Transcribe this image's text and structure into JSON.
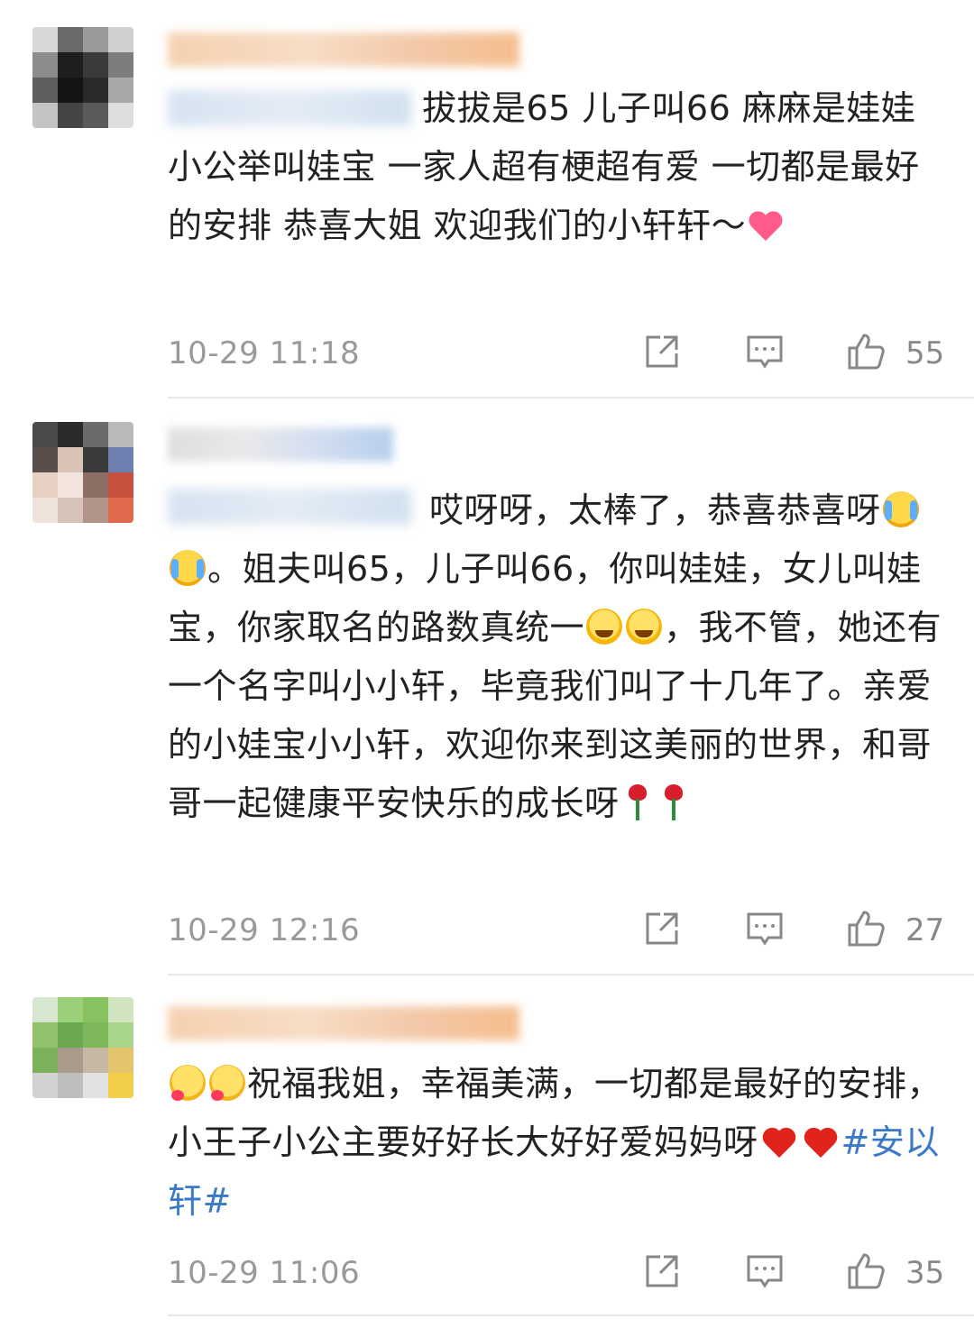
{
  "comments": [
    {
      "text": "拔拔是65 儿子叫66 麻麻是娃娃 小公举叫娃宝 一家人超有梗超有爱 一切都是最好的安排 恭喜大姐 欢迎我们的小轩轩～",
      "time": "10-29 11:18",
      "likes": "55"
    },
    {
      "text_a": "哎呀呀，太棒了，恭喜恭喜呀",
      "text_b": "。姐夫叫65，儿子叫66，你叫娃娃，女儿叫娃宝，你家取名的路数真统一",
      "text_c": "，我不管，她还有一个名字叫小小轩，毕竟我们叫了十几年了。亲爱的小娃宝小小轩，欢迎你来到这美丽的世界，和哥哥一起健康平安快乐的成长呀",
      "time": "10-29 12:16",
      "likes": "27"
    },
    {
      "text": "祝福我姐，幸福美满，一切都是最好的安排，小王子小公主要好好长大好好爱妈妈呀",
      "tag": "#安以轩#",
      "time": "10-29 11:06",
      "likes": "35"
    }
  ],
  "icons": {
    "share": "share-icon",
    "comment": "comment-icon",
    "like": "thumbs-up-icon"
  },
  "colors": {
    "text": "#222222",
    "meta": "#999999",
    "hashtag": "#3a79c8",
    "divider": "#e8e8e8"
  }
}
